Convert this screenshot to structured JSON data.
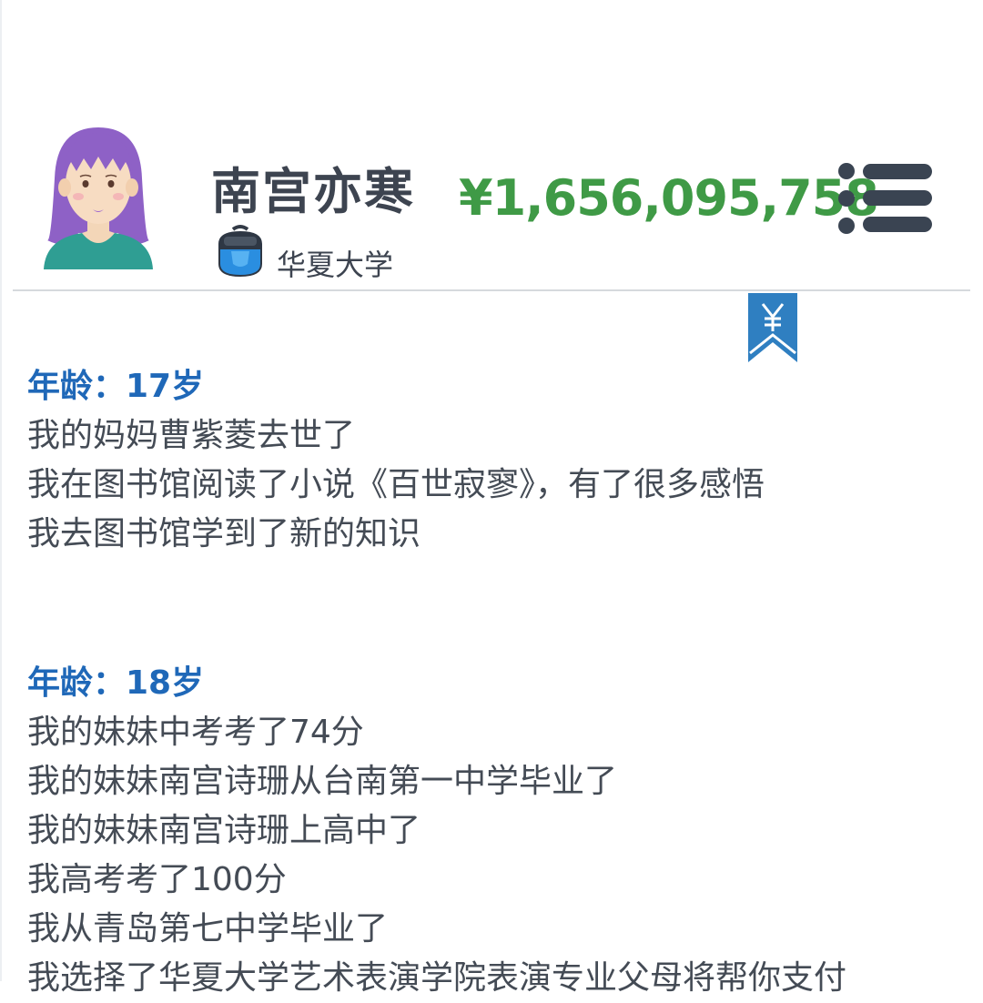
{
  "profile": {
    "name": "南宫亦寒",
    "school": "华夏大学",
    "money": "¥1,656,095,758",
    "avatar_icon": "girl-avatar-icon",
    "school_icon": "backpack-icon",
    "menu_icon": "menu-list-icon",
    "bookmark_icon": "yuan-bookmark-icon"
  },
  "colors": {
    "money": "#3f9a46",
    "age_heading": "#1f68b8",
    "bookmark": "#2f7fc1"
  },
  "timeline": [
    {
      "age": "年龄：17岁",
      "events": [
        "我的妈妈曹紫菱去世了",
        "我在图书馆阅读了小说《百世寂寥》，有了很多感悟",
        "我去图书馆学到了新的知识"
      ]
    },
    {
      "age": "年龄：18岁",
      "events": [
        "我的妹妹中考考了74分",
        "我的妹妹南宫诗珊从台南第一中学毕业了",
        "我的妹妹南宫诗珊上高中了",
        "我高考考了100分",
        "我从青岛第七中学毕业了",
        "我选择了华夏大学艺术表演学院表演专业父母将帮你支付"
      ]
    }
  ]
}
